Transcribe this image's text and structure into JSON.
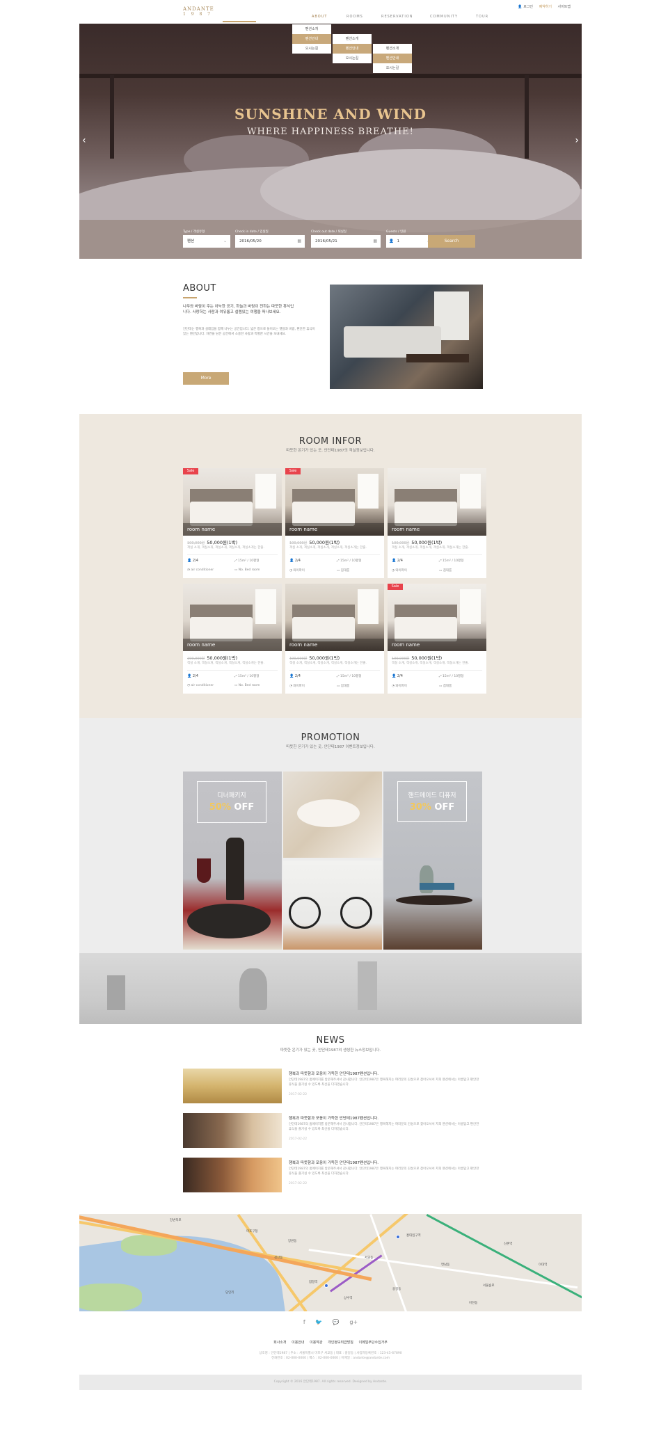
{
  "header": {
    "logo": "ANDANTE",
    "logo_sub": "1 9 8 7",
    "util": {
      "login": "로그인",
      "reservation": "예약하기",
      "sitemap": "사이트맵"
    },
    "nav": [
      "ABOUT",
      "ROOMS",
      "RESERVATION",
      "COMMUNITY",
      "TOUR"
    ],
    "dropdown1": [
      "펜션소개",
      "펜션안내",
      "오시는길"
    ],
    "dropdown2": [
      "펜션소개",
      "펜션안내",
      "오시는길"
    ],
    "dropdown3": [
      "펜션소개",
      "펜션안내",
      "오시는길"
    ]
  },
  "hero": {
    "title": "SUNSHINE AND WIND",
    "subtitle": "WHERE HAPPINESS BREATHE!",
    "prev": "‹",
    "next": "›",
    "booking": {
      "type_label": "Type / 객실유형",
      "type_value": "펜션",
      "checkin_label": "Check in date / 입실일",
      "checkin_value": "2016/05/20",
      "checkout_label": "Check out date / 퇴실일",
      "checkout_value": "2016/05/21",
      "guests_label": "Guests / 인원",
      "guests_value": "1",
      "search": "Search"
    }
  },
  "about": {
    "title": "ABOUT",
    "lead": "나무와 바람이 주는 아늑한 공기, 하늘과 바람이 전하는 따뜻한 휴식입니다. 사랑하는 사람과 여유롭고 설렘있는 여행을 떠나보세요.",
    "body": "안단테는 행복과 설레임을 함께 나누는 공간입니다. 넓은 창으로 들어오는 햇살과 바람, 편안한 휴식이 있는 펜션입니다. 자연을 담은 공간에서 소중한 사람과 특별한 시간을 보내세요.",
    "more": "More"
  },
  "rooms": {
    "title": "ROOM INFOR",
    "subtitle": "따뜻한 온기가 있는 곳, 안단테1987의 객실정보입니다.",
    "sale": "Sale",
    "items": [
      {
        "name": "room name",
        "old": "100,000원",
        "price": "50,000원(1박)",
        "desc": "객실 소개, 객실소개, 객실소개, 객실소개, 객실소개는 한줄.",
        "people": "2/4",
        "size": "15m² / 10평형",
        "opt1": "air conditioner",
        "opt2": "No. Bed room"
      },
      {
        "name": "room name",
        "old": "100,000원",
        "price": "50,000원(1박)",
        "desc": "객실 소개, 객실소개, 객실소개, 객실소개, 객실소개는 한줄.",
        "people": "2/4",
        "size": "15m² / 10평형",
        "opt1": "와이파이",
        "opt2": "침대룸"
      },
      {
        "name": "room name",
        "old": "100,000원",
        "price": "50,000원(1박)",
        "desc": "객실 소개, 객실소개, 객실소개, 객실소개, 객실소개는 한줄.",
        "people": "2/4",
        "size": "15m² / 10평형",
        "opt1": "와이파이",
        "opt2": "침대룸"
      },
      {
        "name": "room name",
        "old": "100,000원",
        "price": "50,000원(1박)",
        "desc": "객실 소개, 객실소개, 객실소개, 객실소개, 객실소개는 한줄.",
        "people": "2/4",
        "size": "15m² / 10평형",
        "opt1": "air conditioner",
        "opt2": "No. Bed room"
      },
      {
        "name": "room name",
        "old": "100,000원",
        "price": "50,000원(1박)",
        "desc": "객실 소개, 객실소개, 객실소개, 객실소개, 객실소개는 한줄.",
        "people": "2/4",
        "size": "15m² / 10평형",
        "opt1": "와이파이",
        "opt2": "침대룸"
      },
      {
        "name": "room name",
        "old": "100,000원",
        "price": "50,000원(1박)",
        "desc": "객실 소개, 객실소개, 객실소개, 객실소개, 객실소개는 한줄.",
        "people": "2/4",
        "size": "15m² / 10평형",
        "opt1": "와이파이",
        "opt2": "침대룸"
      }
    ]
  },
  "promotion": {
    "title": "PROMOTION",
    "subtitle": "따뜻한 온기가 있는 곳, 안단테1987 이벤트정보입니다.",
    "left_name": "디너패키지",
    "left_pct": "50%",
    "left_off": "OFF",
    "right_name": "핸드메이드 디퓨저",
    "right_pct": "30%",
    "right_off": "OFF"
  },
  "news": {
    "title": "NEWS",
    "subtitle": "따뜻한 온기가 있는 곳, 안단테1987의 생생한 뉴스정보입니다.",
    "items": [
      {
        "title": "행복과 따뜻함과 포옹이 가득한 안단테1987펜션입니다.",
        "body": "안단테1987의 홈페이지를 방문해주셔서 감사합니다. 안단테1987은 행복해지는 여러분의 감성으로 찾아오셔서 저희 펜션에서는 아름답고 편안한 휴식을 즐기실 수 있도록 최선을 다하겠습니다.",
        "date": "2017-02-22"
      },
      {
        "title": "행복과 따뜻함과 포옹이 가득한 안단테1987펜션입니다.",
        "body": "안단테1987의 홈페이지를 방문해주셔서 감사합니다. 안단테1987은 행복해지는 여러분의 감성으로 찾아오셔서 저희 펜션에서는 아름답고 편안한 휴식을 즐기실 수 있도록 최선을 다하겠습니다.",
        "date": "2017-02-22"
      },
      {
        "title": "행복과 따뜻함과 포옹이 가득한 안단테1987펜션입니다.",
        "body": "안단테1987의 홈페이지를 방문해주셔서 감사합니다. 안단테1987은 행복해지는 여러분의 감성으로 찾아오셔서 저희 펜션에서는 아름답고 편안한 휴식을 즐기실 수 있도록 최선을 다하겠습니다.",
        "date": "2017-02-22"
      }
    ]
  },
  "map": {
    "labels": [
      "강변북로",
      "마포구청",
      "망원동",
      "합정역",
      "서교동",
      "홍대입구역",
      "연남동",
      "성산동",
      "상수역",
      "당인리",
      "서울숲로",
      "신촌역",
      "이대역",
      "아현동",
      "용강동"
    ]
  },
  "footer": {
    "social": [
      "f",
      "🐦",
      "💬",
      "g+"
    ],
    "links": [
      "회사소개",
      "이용안내",
      "이용약관",
      "개인정보취급방침",
      "이메일무단수집거부"
    ],
    "info1": "상호명 : 안단테1987 | 주소 : 서울특별시 마포구 서교동 | 대표 : 홍길동 | 사업자등록번호 : 123-45-67890",
    "info2": "전화번호 : 02-000-0000 | 팩스 : 02-000-0000 | 이메일 : andante@andante.com",
    "copyright": "Copyright © 2016 안단테1987. All rights reserved. Designed by Andante."
  }
}
